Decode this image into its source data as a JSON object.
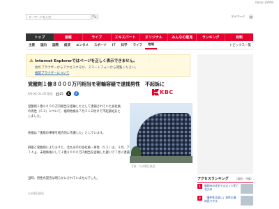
{
  "topbar": {
    "link": "Yahoo! JAPAN"
  },
  "header": {
    "search_placeholder": "キーワードを入力",
    "search_button": "🔍",
    "my_page": "マイページ",
    "settings": "設定"
  },
  "navbar": {
    "items": [
      "トップ",
      "速報",
      "ライブ",
      "エキスパート",
      "オリジナル",
      "みんなの意見",
      "ランキング",
      "有料"
    ]
  },
  "subnav": {
    "items": [
      "主要",
      "国内",
      "国際",
      "経済",
      "エンタメ",
      "スポーツ",
      "IT",
      "科学",
      "ライフ",
      "地域"
    ],
    "topics": "トピックス一覧"
  },
  "warning": {
    "title": "Internet Explorerではページを正しく表示できません。",
    "body": "他のブラウザーからアクセスするか、スマートフォンから閲覧ください。",
    "link": "推奨ブラウザーについて"
  },
  "article": {
    "title": "覚醒剤１億８０００万円相当を密輸容疑で逮捕男性　不起訴に",
    "date": "6/6(木) 21:00 配信",
    "comments": "25",
    "source": "KBC",
    "p1": "覚醒剤１億８０００万円相当を密輸したとして逮捕されていた会社員の男性（５２）について、福岡地検は７月３１日付けで不起訴処分としました。",
    "p2": "地検は「諸般の事情を総合的に考慮した」としています。",
    "p3": "麻薬と覚醒剤によりますと、北九州市の会社員・男性（５２）は、３月、アメリカ・ロサンゼルス空港から覚醒剤約２．７４ｇ、末端価格にして１億８０００万円相当を密輸した疑いで７月に逮捕されていました。",
    "p4": "当時、男性の認否は明らかにされていませんでした。",
    "credit": "九州朝日放送",
    "photo_caption": "写真：九州朝日放送"
  },
  "ranking": {
    "title": "アクセスランキング",
    "region": "（福岡・沖縄）",
    "items": [
      {
        "rank": "1",
        "text": "福岡市の住宅で火災 1人死亡 北九州"
      },
      {
        "rank": "2",
        "text": "「事件性は低い」男性の遺体見つかる"
      }
    ]
  }
}
